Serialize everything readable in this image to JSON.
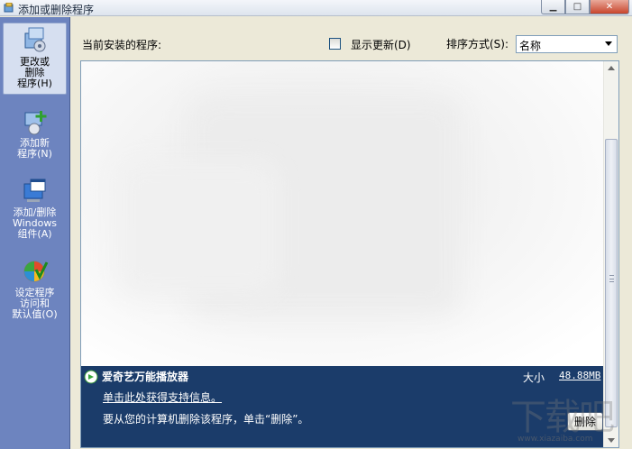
{
  "window": {
    "title": "添加或删除程序",
    "minimize_glyph": "▁",
    "maximize_glyph": "□",
    "close_glyph": "✕"
  },
  "sidebar": {
    "items": [
      {
        "label": "更改或\n删除\n程序(H)",
        "icon": "change-remove-programs-icon",
        "active": true
      },
      {
        "label": "添加新\n程序(N)",
        "icon": "add-new-programs-icon",
        "active": false
      },
      {
        "label": "添加/删除\nWindows\n组件(A)",
        "icon": "windows-components-icon",
        "active": false
      },
      {
        "label": "设定程序\n访问和\n默认值(O)",
        "icon": "program-defaults-icon",
        "active": false
      }
    ]
  },
  "toolbar": {
    "current_label": "当前安装的程序:",
    "show_updates_label": "显示更新(D)",
    "show_updates_checked": false,
    "sort_label": "排序方式(S):",
    "sort_value": "名称"
  },
  "selected_program": {
    "name": "爱奇艺万能播放器",
    "size_label": "大小",
    "size_value": "48.88MB",
    "support_link": "单击此处获得支持信息。",
    "remove_hint": "要从您的计算机删除该程序，单击“删除”。",
    "remove_button": "删除"
  },
  "watermark": {
    "big_text": "下载吧",
    "small_text": "www.xiazaiba.com"
  },
  "colors": {
    "sidebar_bg": "#6d84bf",
    "selected_bg": "#1b3c6a",
    "window_bg": "#ece9d8"
  }
}
